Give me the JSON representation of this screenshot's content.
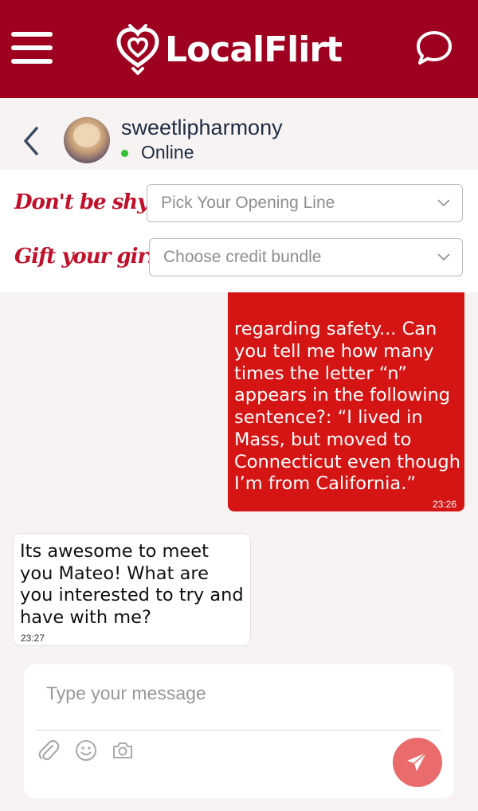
{
  "app": {
    "brand": "LocalFlirt"
  },
  "header": {
    "menu_icon": "hamburger-menu-icon",
    "logo_icon": "heart-arrow-logo-icon",
    "chat_icon": "speech-bubble-icon",
    "brand_color": "#9e0020"
  },
  "profile": {
    "username": "sweetlipharmony",
    "status": "Online",
    "status_color": "#35c135",
    "back_icon": "chevron-left-icon",
    "avatar_icon": "user-avatar"
  },
  "options": {
    "opening_line": {
      "label": "Don't be shy",
      "placeholder": "Pick Your Opening Line"
    },
    "credit_bundle": {
      "label": "Gift your girl",
      "placeholder": "Choose credit bundle"
    }
  },
  "messages": [
    {
      "direction": "outgoing",
      "text": "regarding safety... Can you tell me how many times the letter “n” appears in the following sentence?: “I lived in Mass, but moved to Connecticut even though I’m from California.”",
      "time": "23:26",
      "color": "#d51414"
    },
    {
      "direction": "incoming",
      "text": "Its awesome to meet you Mateo! What are you interested to try and have with me?",
      "time": "23:27"
    }
  ],
  "composer": {
    "placeholder": "Type your message",
    "attach_icon": "paperclip-icon",
    "emoji_icon": "smiley-icon",
    "camera_icon": "camera-icon",
    "send_icon": "paper-plane-icon",
    "send_color": "#e96b6b"
  }
}
